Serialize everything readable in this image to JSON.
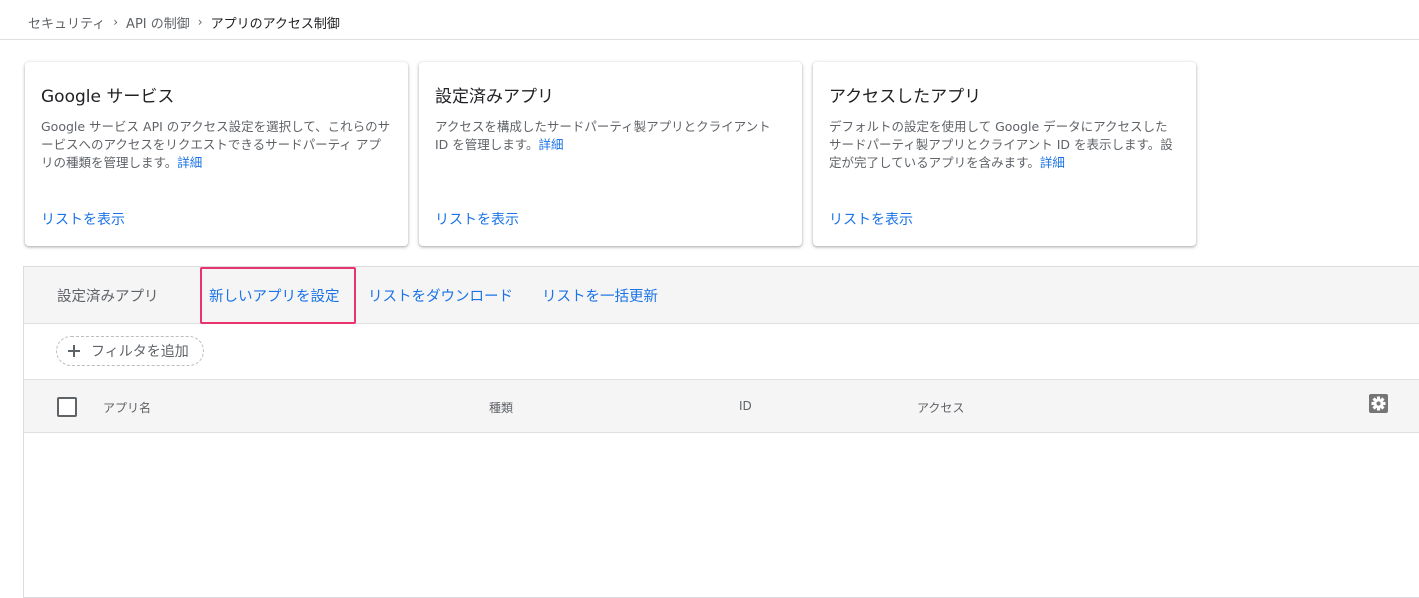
{
  "breadcrumb": {
    "items": [
      "セキュリティ",
      "API の制御"
    ],
    "current": "アプリのアクセス制御"
  },
  "cards": [
    {
      "title": "Google サービス",
      "description": "Google サービス API のアクセス設定を選択して、これらのサービスへのアクセスをリクエストできるサードパーティ アプリの種類を管理します。",
      "detail": "詳細",
      "action": "リストを表示"
    },
    {
      "title": "設定済みアプリ",
      "description": "アクセスを構成したサードパーティ製アプリとクライアント ID を管理します。",
      "detail": "詳細",
      "action": "リストを表示"
    },
    {
      "title": "アクセスしたアプリ",
      "description": "デフォルトの設定を使用して Google データにアクセスしたサードパーティ製アプリとクライアント ID を表示します。設定が完了しているアプリを含みます。",
      "detail": "詳細",
      "action": "リストを表示"
    }
  ],
  "toolbar": {
    "title": "設定済みアプリ",
    "actions": [
      "新しいアプリを設定",
      "リストをダウンロード",
      "リストを一括更新"
    ]
  },
  "filter": {
    "label": "フィルタを追加"
  },
  "table": {
    "columns": [
      "アプリ名",
      "種類",
      "ID",
      "アクセス"
    ]
  },
  "colors": {
    "link": "#1a73e8",
    "highlight": "#e8336d",
    "header_bg": "#f5f5f5"
  },
  "icons": {
    "breadcrumb_separator": "chevron-right-icon",
    "filter": "plus-icon",
    "settings": "gear-icon"
  }
}
